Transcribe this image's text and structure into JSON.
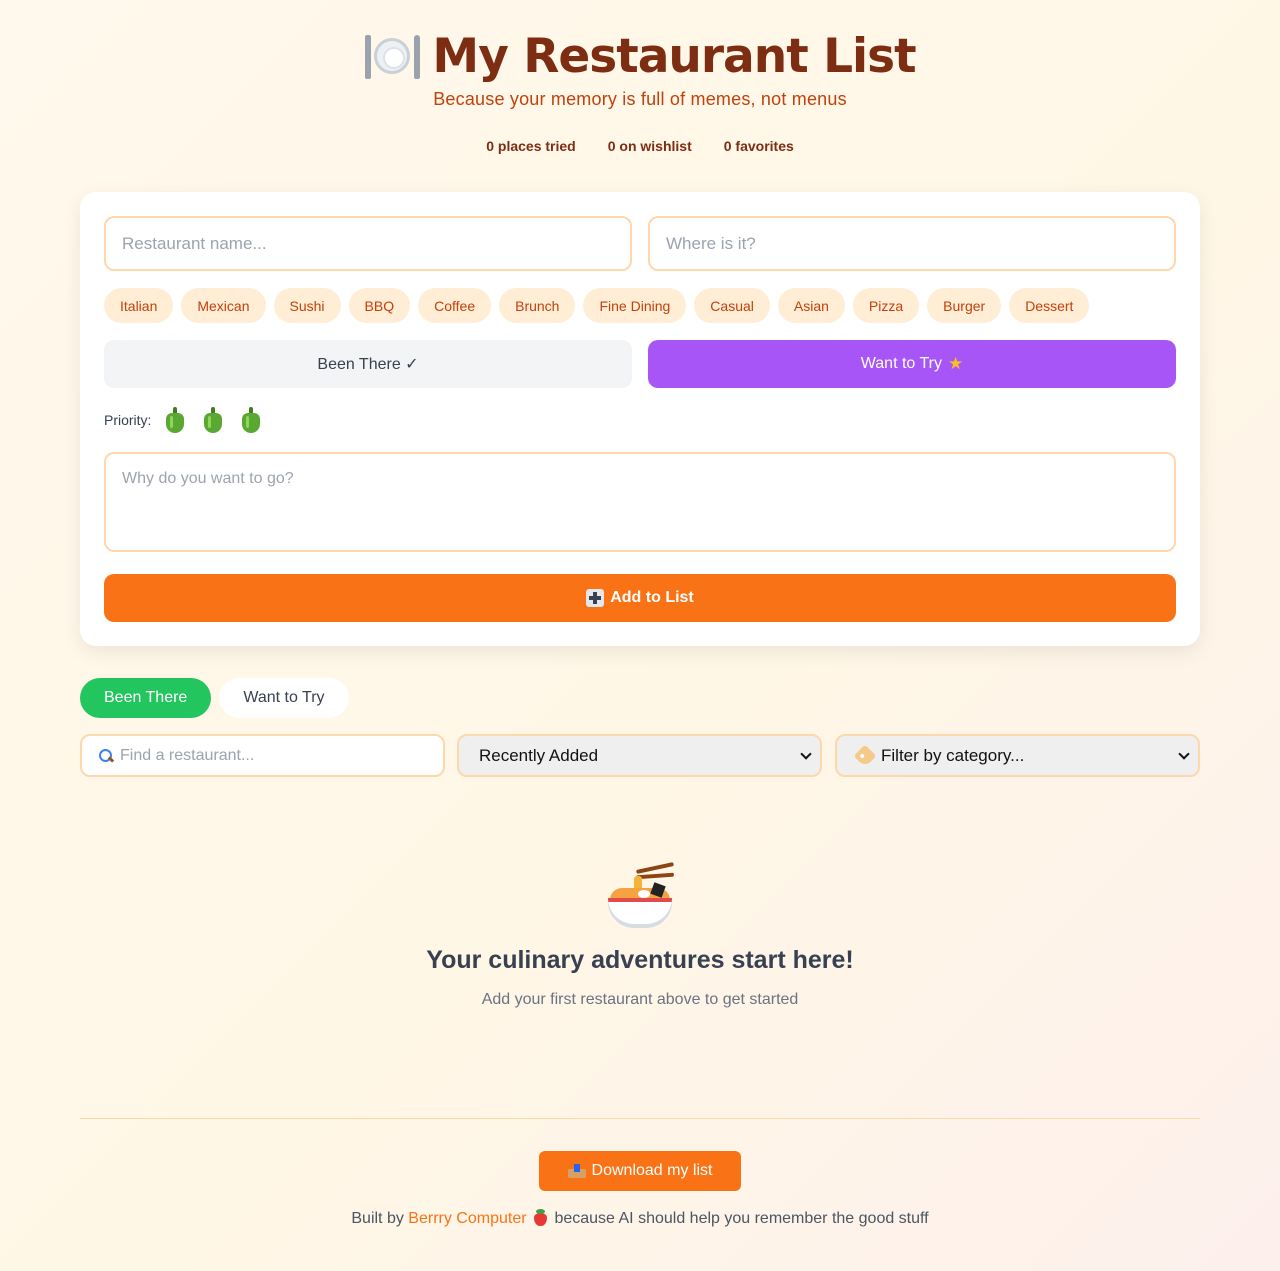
{
  "header": {
    "title": "My Restaurant List",
    "subtitle": "Because your memory is full of memes, not menus",
    "stats": {
      "tried": "0 places tried",
      "wishlist": "0 on wishlist",
      "favorites": "0 favorites"
    }
  },
  "form": {
    "name_placeholder": "Restaurant name...",
    "location_placeholder": "Where is it?",
    "categories": [
      "Italian",
      "Mexican",
      "Sushi",
      "BBQ",
      "Coffee",
      "Brunch",
      "Fine Dining",
      "Casual",
      "Asian",
      "Pizza",
      "Burger",
      "Dessert"
    ],
    "status_been": "Been There ✓",
    "status_want": "Want to Try",
    "status_selected": "Want to Try",
    "priority_label": "Priority:",
    "priority_level": 3,
    "priority_max": 3,
    "notes_placeholder": "Why do you want to go?",
    "add_button": "Add to List"
  },
  "list": {
    "tabs": [
      "Been There",
      "Want to Try"
    ],
    "active_tab": "Been There",
    "search_placeholder": "Find a restaurant...",
    "sort_selected": "Recently Added",
    "filter_selected": "Filter by category..."
  },
  "empty_state": {
    "title": "Your culinary adventures start here!",
    "subtitle": "Add your first restaurant above to get started"
  },
  "footer": {
    "download_button": "Download my list",
    "built_by": "Built by",
    "link_text": "Berrry Computer",
    "tagline": "because AI should help you remember the good stuff"
  },
  "colors": {
    "accent": "#f97316",
    "title": "#7c2d12",
    "subtitle": "#c2410c",
    "chip_bg": "#ffedd5",
    "want_active": "#a855f7",
    "tab_active": "#22c55e"
  }
}
